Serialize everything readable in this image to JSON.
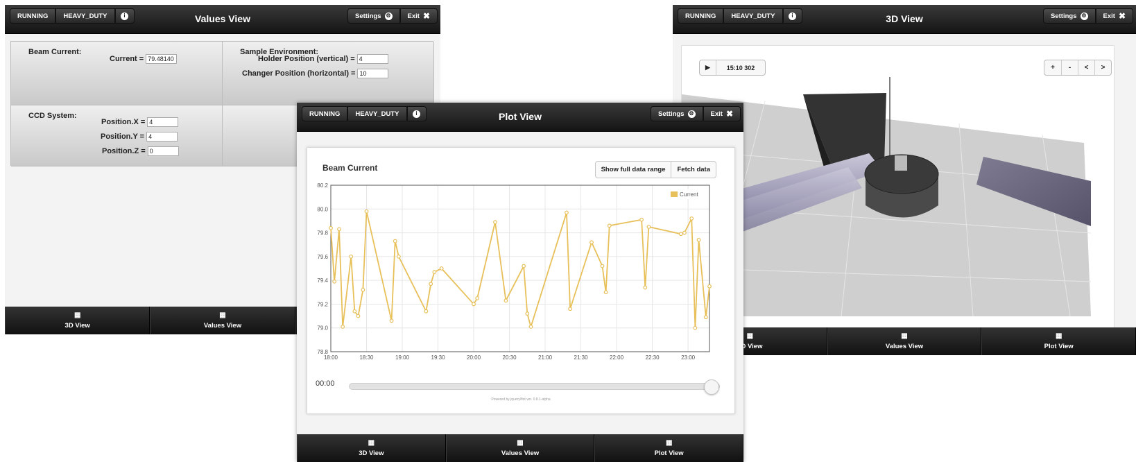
{
  "header_buttons": {
    "running": "RUNNING",
    "heavy_duty": "HEAVY_DUTY",
    "settings": "Settings",
    "exit": "Exit"
  },
  "nav": {
    "view3d": "3D View",
    "values": "Values View",
    "plot": "Plot View"
  },
  "values_view": {
    "title": "Values View",
    "beam": {
      "heading": "Beam Current:",
      "current_label": "Current =",
      "current_value": "79.48140"
    },
    "sample": {
      "heading": "Sample Environment:",
      "holder_label": "Holder Position (vertical) =",
      "holder_value": "4",
      "changer_label": "Changer Position (horizontal) =",
      "changer_value": "10"
    },
    "ccd": {
      "heading": "CCD System:",
      "x_label": "Position.X =",
      "x_value": "4",
      "y_label": "Position.Y =",
      "y_value": "4",
      "z_label": "Position.Z =",
      "z_value": "0"
    }
  },
  "view_3d": {
    "title": "3D View",
    "play_icon": "▶",
    "time": "15:10 302",
    "controls": [
      "+",
      "-",
      "<",
      ">"
    ]
  },
  "plot_view": {
    "title": "Plot View",
    "buttons": {
      "full_range": "Show full data range",
      "fetch": "Fetch data"
    },
    "time_label": "00:00",
    "slider_fraction": 1.0,
    "powered_by": "Powered by jquery/flot ver. 0.8.1-alpha"
  },
  "chart_data": {
    "type": "line",
    "title": "Beam Current",
    "xlabel": "",
    "ylabel": "",
    "legend_position": "top-right",
    "series": [
      {
        "name": "Current",
        "color": "#e8c05a",
        "points": [
          [
            "18:00",
            79.84
          ],
          [
            "18:03",
            79.39
          ],
          [
            "18:07",
            79.83
          ],
          [
            "18:10",
            79.01
          ],
          [
            "18:17",
            79.6
          ],
          [
            "18:20",
            79.14
          ],
          [
            "18:23",
            79.1
          ],
          [
            "18:27",
            79.32
          ],
          [
            "18:30",
            79.98
          ],
          [
            "18:51",
            79.06
          ],
          [
            "18:54",
            79.73
          ],
          [
            "18:57",
            79.6
          ],
          [
            "19:20",
            79.14
          ],
          [
            "19:24",
            79.37
          ],
          [
            "19:27",
            79.47
          ],
          [
            "19:33",
            79.5
          ],
          [
            "20:00",
            79.2
          ],
          [
            "20:03",
            79.25
          ],
          [
            "20:18",
            79.89
          ],
          [
            "20:27",
            79.23
          ],
          [
            "20:42",
            79.52
          ],
          [
            "20:45",
            79.12
          ],
          [
            "20:48",
            79.01
          ],
          [
            "21:18",
            79.97
          ],
          [
            "21:21",
            79.16
          ],
          [
            "21:39",
            79.72
          ],
          [
            "21:48",
            79.52
          ],
          [
            "21:51",
            79.3
          ],
          [
            "21:54",
            79.86
          ],
          [
            "22:21",
            79.91
          ],
          [
            "22:24",
            79.34
          ],
          [
            "22:27",
            79.85
          ],
          [
            "22:54",
            79.79
          ],
          [
            "22:57",
            79.8
          ],
          [
            "23:03",
            79.92
          ],
          [
            "23:06",
            79.0
          ],
          [
            "23:09",
            79.74
          ],
          [
            "23:15",
            79.09
          ],
          [
            "23:18",
            79.35
          ]
        ]
      }
    ],
    "x_ticks": [
      "18:00",
      "18:30",
      "19:00",
      "19:30",
      "20:00",
      "20:30",
      "21:00",
      "21:30",
      "22:00",
      "22:30",
      "23:00"
    ],
    "y_ticks": [
      "78.8",
      "79.0",
      "79.2",
      "79.4",
      "79.6",
      "79.8",
      "80.0",
      "80.2"
    ],
    "xlim": [
      "18:00",
      "23:18"
    ],
    "ylim": [
      78.8,
      80.2
    ],
    "grid": true
  }
}
